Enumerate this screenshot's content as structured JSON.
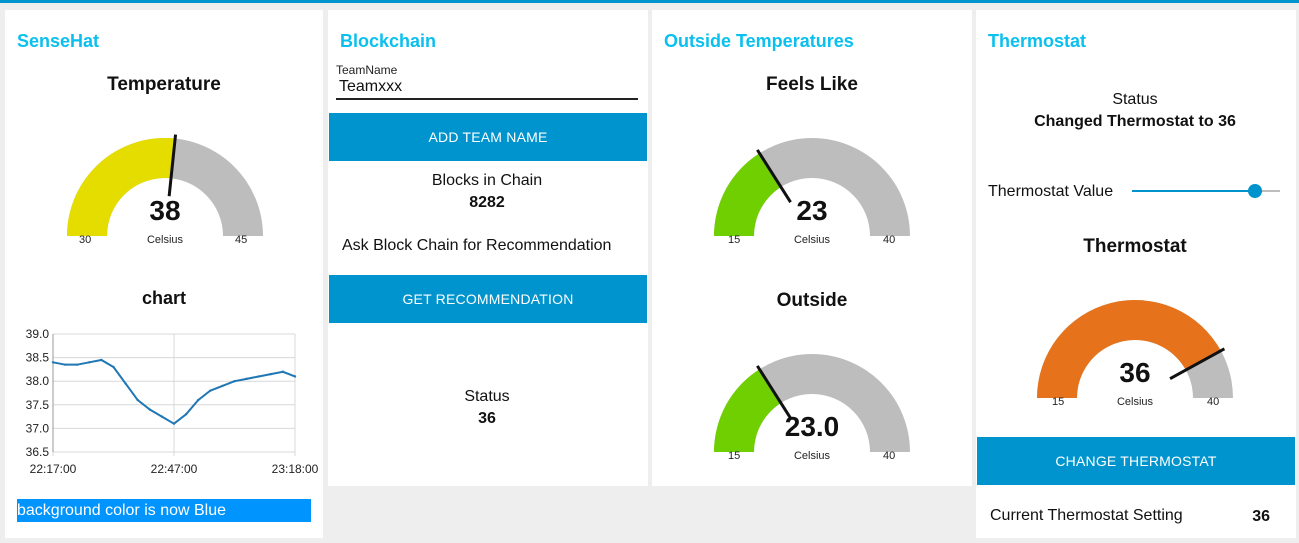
{
  "colors": {
    "accent": "#0094ce",
    "title": "#0ac0ee",
    "gauge_yellow": "#e6dd00",
    "gauge_green": "#6fcf00",
    "gauge_orange": "#e6731c",
    "gauge_track": "#bdbdbd",
    "chart_line": "#1f77b4"
  },
  "sensehat": {
    "title": "SenseHat",
    "temp_gauge": {
      "title": "Temperature",
      "value": "38",
      "unit": "Celsius",
      "min": "30",
      "max": "45",
      "fraction": 0.533
    },
    "chart_title": "chart",
    "status_text": "background color is now Blue"
  },
  "chart_data": {
    "type": "line",
    "title": "chart",
    "xlabel": "",
    "ylabel": "",
    "x_tick_labels": [
      "22:17:00",
      "22:47:00",
      "23:18:00"
    ],
    "y_tick_labels": [
      "39.0",
      "38.5",
      "38.0",
      "37.5",
      "37.0",
      "36.5"
    ],
    "ylim": [
      36.5,
      39.0
    ],
    "grid": true,
    "series": [
      {
        "x": [
          "22:17:00",
          "22:20:00",
          "22:23:00",
          "22:26:00",
          "22:29:00",
          "22:32:00",
          "22:35:00",
          "22:38:00",
          "22:41:00",
          "22:44:00",
          "22:47:00",
          "22:50:00",
          "22:53:00",
          "22:56:00",
          "22:59:00",
          "23:02:00",
          "23:05:00",
          "23:08:00",
          "23:11:00",
          "23:14:00",
          "23:17:00"
        ],
        "values": [
          38.4,
          38.35,
          38.35,
          38.4,
          38.45,
          38.3,
          37.95,
          37.6,
          37.4,
          37.25,
          37.1,
          37.3,
          37.6,
          37.8,
          37.9,
          38.0,
          38.05,
          38.1,
          38.15,
          38.2,
          38.1
        ]
      }
    ]
  },
  "blockchain": {
    "title": "Blockchain",
    "teamname_label": "TeamName",
    "teamname_value": "Teamxxx",
    "add_button": "ADD TEAM NAME",
    "blocks_label": "Blocks in Chain",
    "blocks_value": "8282",
    "ask_text": "Ask Block Chain for Recommendation",
    "recommend_button": "GET RECOMMENDATION",
    "status_label": "Status",
    "status_value": "36"
  },
  "outside": {
    "title": "Outside Temperatures",
    "feels": {
      "title": "Feels Like",
      "value": "23",
      "unit": "Celsius",
      "min": "15",
      "max": "40",
      "fraction": 0.32
    },
    "outside": {
      "title": "Outside",
      "value": "23.0",
      "unit": "Celsius",
      "min": "15",
      "max": "40",
      "fraction": 0.32
    }
  },
  "thermostat": {
    "title": "Thermostat",
    "status_label": "Status",
    "status_value": "Changed Thermostat to 36",
    "slider_label": "Thermostat Value",
    "slider_fraction": 0.83,
    "gauge": {
      "title": "Thermostat",
      "value": "36",
      "unit": "Celsius",
      "min": "15",
      "max": "40",
      "fraction": 0.84
    },
    "change_button": "CHANGE THERMOSTAT",
    "current_label": "Current Thermostat Setting",
    "current_value": "36"
  }
}
